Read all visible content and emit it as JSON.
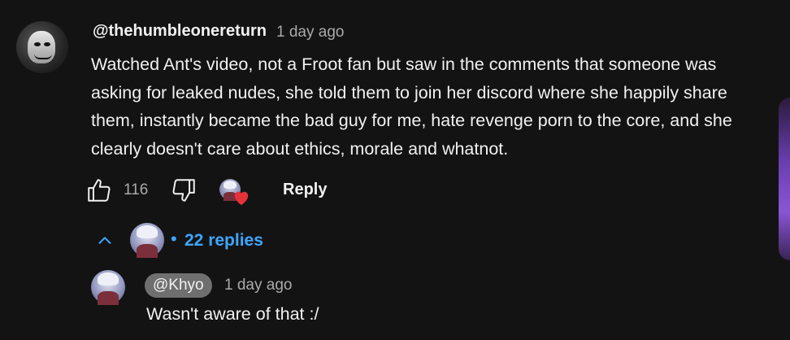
{
  "comment": {
    "author": "@thehumbleonereturn",
    "timestamp": "1 day ago",
    "text_lines": [
      "Watched Ant's video, not a Froot fan but saw in the comments that someone was",
      "asking for leaked nudes, she told them to join her discord where she happily share",
      "them, instantly became the bad guy for me, hate revenge porn to the core, and she",
      "clearly doesn't care about ethics, morale and whatnot."
    ],
    "like_count": "116",
    "reply_label": "Reply",
    "icons": {
      "like": "thumbs-up-icon",
      "dislike": "thumbs-down-icon",
      "creator_heart": "creator-heart-icon"
    }
  },
  "replies": {
    "toggle_dot": "•",
    "count_label": "22 replies",
    "expand_icon": "chevron-up-icon"
  },
  "reply": {
    "author": "@Khyo",
    "timestamp": "1 day ago",
    "text": "Wasn't aware of that :/"
  },
  "colors": {
    "background": "#131313",
    "text": "#f1f1f1",
    "secondary_text": "#aaaaaa",
    "link_blue": "#3ea6ff",
    "heart_red": "#e5323a",
    "author_chip": "#6f6f6f"
  }
}
